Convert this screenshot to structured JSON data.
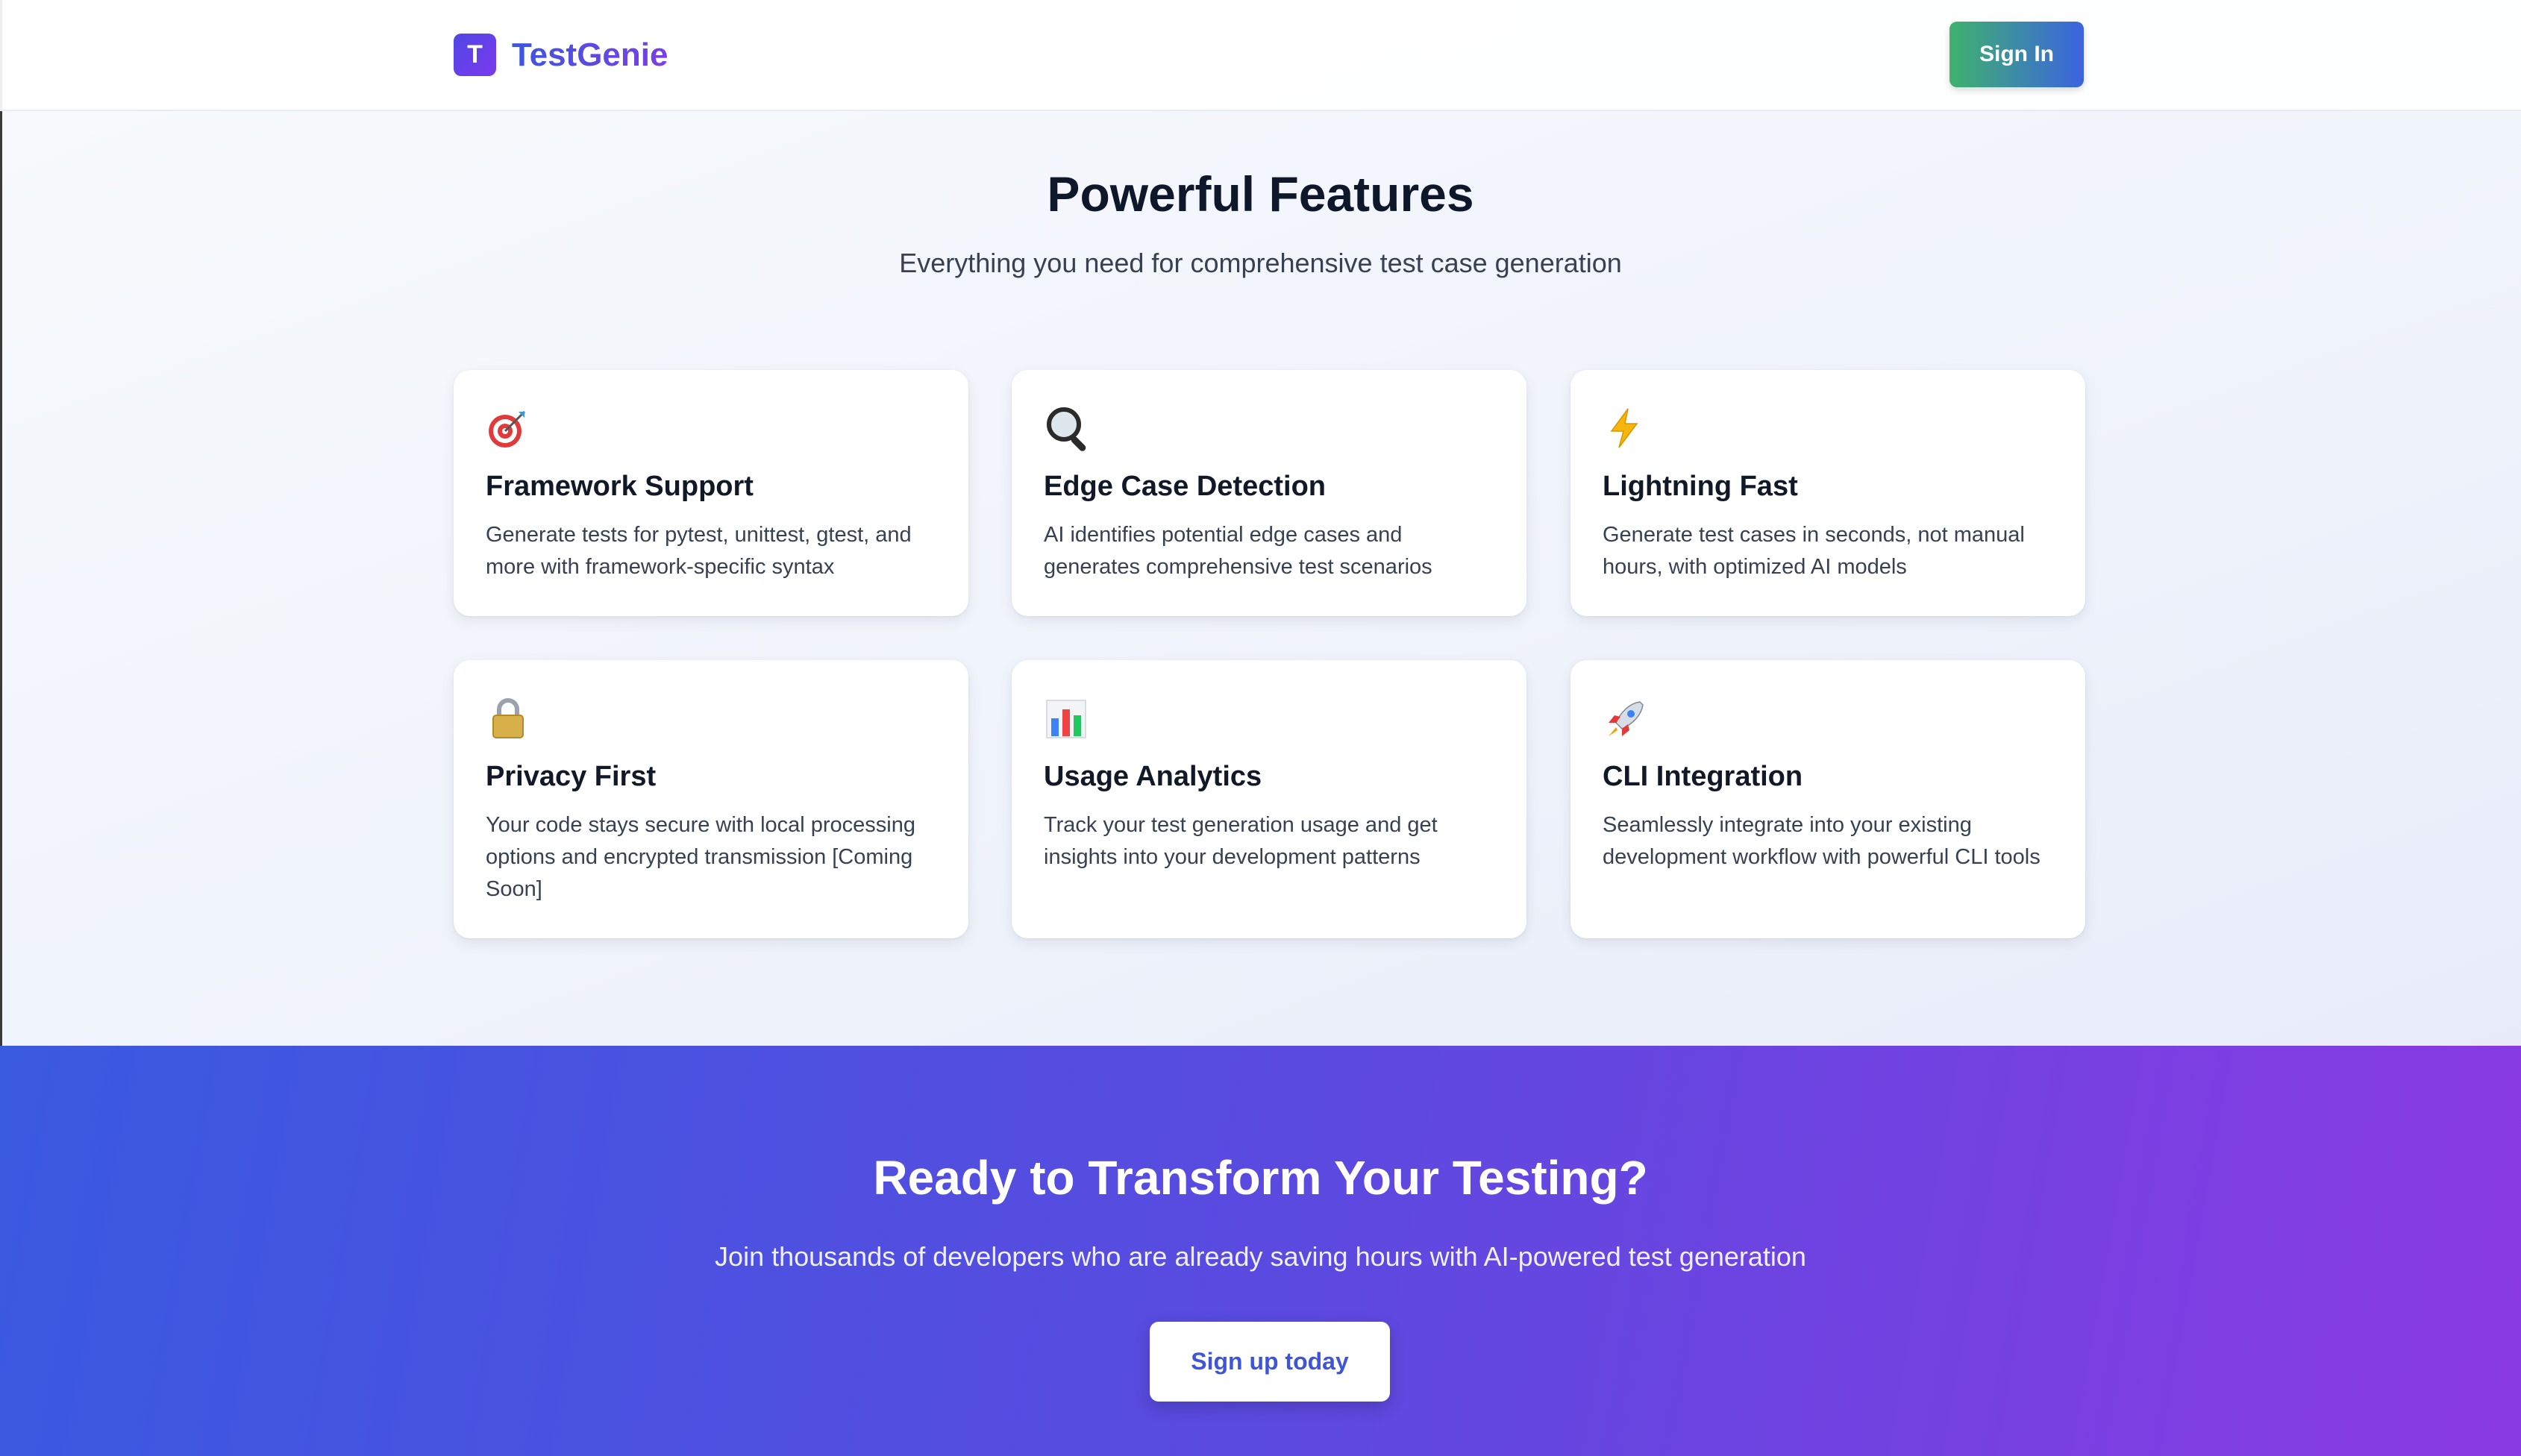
{
  "brand": {
    "logo_letter": "T",
    "name": "TestGenie"
  },
  "nav": {
    "signin_label": "Sign In"
  },
  "features": {
    "title": "Powerful Features",
    "subtitle": "Everything you need for comprehensive test case generation",
    "cards": [
      {
        "icon": "target-icon",
        "title": "Framework Support",
        "description": "Generate tests for pytest, unittest, gtest, and more with framework-specific syntax"
      },
      {
        "icon": "magnifier-icon",
        "title": "Edge Case Detection",
        "description": "AI identifies potential edge cases and generates comprehensive test scenarios"
      },
      {
        "icon": "lightning-icon",
        "title": "Lightning Fast",
        "description": "Generate test cases in seconds, not manual hours, with optimized AI models"
      },
      {
        "icon": "lock-icon",
        "title": "Privacy First",
        "description": "Your code stays secure with local processing options and encrypted transmission [Coming Soon]"
      },
      {
        "icon": "bar-chart-icon",
        "title": "Usage Analytics",
        "description": "Track your test generation usage and get insights into your development patterns"
      },
      {
        "icon": "rocket-icon",
        "title": "CLI Integration",
        "description": "Seamlessly integrate into your existing development workflow with powerful CLI tools"
      }
    ]
  },
  "cta": {
    "title": "Ready to Transform Your Testing?",
    "subtitle": "Join thousands of developers who are already saving hours with AI-powered test generation",
    "button_label": "Sign up today"
  },
  "colors": {
    "brand_gradient_start": "#4f46e5",
    "brand_gradient_end": "#7c3aed",
    "signin_gradient_start": "#3fb26d",
    "signin_gradient_end": "#3b63e0",
    "cta_gradient_start": "#3a5ae0",
    "cta_gradient_end": "#8a3ae2"
  }
}
